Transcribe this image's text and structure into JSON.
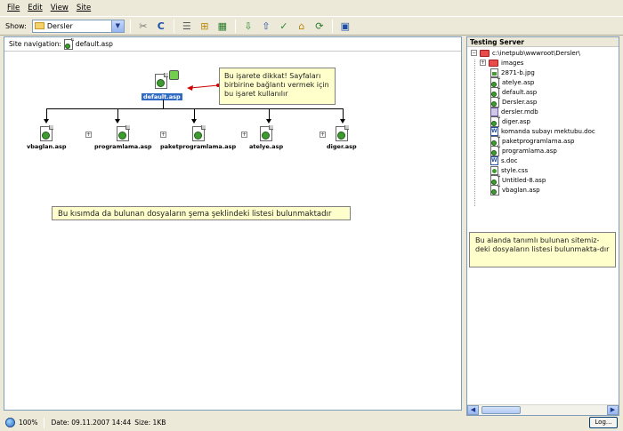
{
  "menubar": {
    "items": [
      {
        "label": "File"
      },
      {
        "label": "Edit"
      },
      {
        "label": "View"
      },
      {
        "label": "Site"
      }
    ]
  },
  "toolbar": {
    "show_label": "Show:",
    "site_select_value": "Dersler",
    "icons": [
      "disconnect-icon",
      "refresh-icon",
      "file-list-icon",
      "site-map-icon",
      "site-map-options-icon",
      "get-icon",
      "put-icon",
      "check-out-icon",
      "check-in-icon",
      "synchronize-icon",
      "expand-icon"
    ]
  },
  "site_nav": {
    "label": "Site navigation:",
    "file": "default.asp"
  },
  "site_map": {
    "root": "default.asp",
    "children": [
      "vbaglan.asp",
      "programlama.asp",
      "paketprogramlama.asp",
      "atelye.asp",
      "diger.asp"
    ],
    "callout_link": "Bu işarete dikkat! Sayfaları birbirine bağlantı vermek için bu işaret kullanılır",
    "callout_list": "Bu kısımda da bulunan dosyaların şema şeklindeki listesi bulunmaktadır"
  },
  "testing_server": {
    "title": "Testing Server",
    "root_path": "c:\\inetpub\\wwwroot\\Dersler\\",
    "items": [
      {
        "name": "images",
        "type": "folder"
      },
      {
        "name": "2871-b.jpg",
        "type": "image"
      },
      {
        "name": "atelye.asp",
        "type": "asp"
      },
      {
        "name": "default.asp",
        "type": "asp"
      },
      {
        "name": "Dersler.asp",
        "type": "asp"
      },
      {
        "name": "dersler.mdb",
        "type": "mdb"
      },
      {
        "name": "diger.asp",
        "type": "asp"
      },
      {
        "name": "komanda subayı mektubu.doc",
        "type": "doc"
      },
      {
        "name": "paketprogramlama.asp",
        "type": "asp"
      },
      {
        "name": "programlama.asp",
        "type": "asp"
      },
      {
        "name": "s.doc",
        "type": "doc"
      },
      {
        "name": "style.css",
        "type": "css"
      },
      {
        "name": "Untitled-8.asp",
        "type": "asp"
      },
      {
        "name": "vbaglan.asp",
        "type": "asp"
      }
    ],
    "callout": "Bu alanda tanımlı bulunan sitemiz-deki dosyaların listesi bulunmakta-dır"
  },
  "status": {
    "zoom": "100%",
    "date": "Date: 09.11.2007 14:44",
    "size": "Size: 1KB",
    "log_button": "Log..."
  },
  "colors": {
    "selection": "#316ac5",
    "callout_bg": "#ffffcc",
    "link_arrow": "#cc0000"
  }
}
